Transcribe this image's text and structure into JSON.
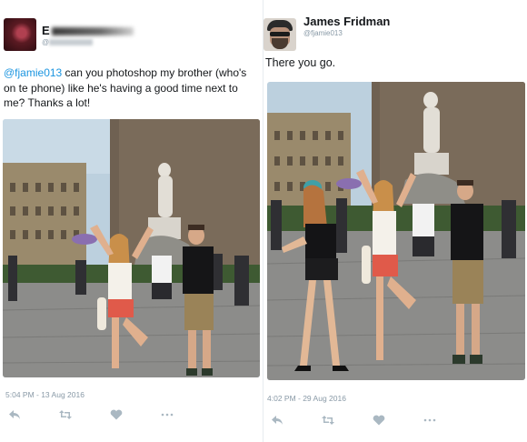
{
  "left_tweet": {
    "author": {
      "name_visible": "E",
      "handle_visible": "@"
    },
    "mention": "@fjamie013",
    "text": " can you photoshop my brother (who's on te phone) like he's having a good time next to me? Thanks a lot!",
    "timestamp": "5:04 PM - 13 Aug 2016",
    "actions": {
      "reply_icon": "reply-icon",
      "retweet_icon": "retweet-icon",
      "like_icon": "heart-icon",
      "more_icon": "more-icon"
    }
  },
  "right_tweet": {
    "author": {
      "name": "James Fridman",
      "handle": "@fjamie013"
    },
    "text": "There you go.",
    "timestamp": "4:02 PM - 29 Aug 2016",
    "actions": {
      "reply_icon": "reply-icon",
      "retweet_icon": "retweet-icon",
      "like_icon": "heart-icon",
      "more_icon": "more-icon"
    }
  },
  "colors": {
    "mention": "#1b95e0",
    "muted": "#8899a6",
    "icon": "#aab8c2",
    "text": "#14171a"
  }
}
